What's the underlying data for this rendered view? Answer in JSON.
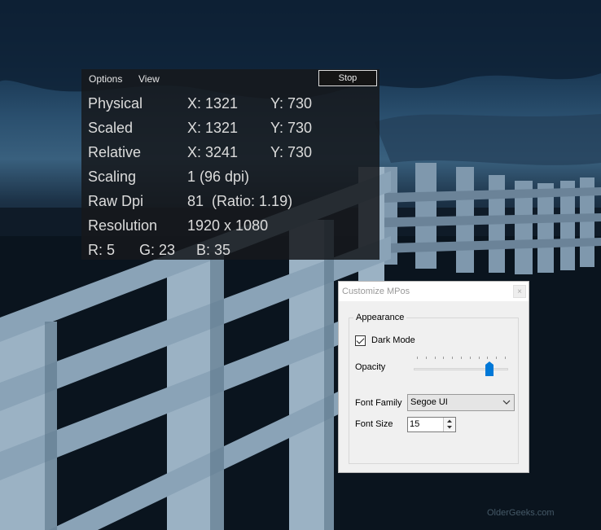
{
  "overlay": {
    "menu": {
      "options": "Options",
      "view": "View"
    },
    "stop_label": "Stop",
    "rows": [
      {
        "label": "Physical",
        "x": "X: 1321",
        "y": "Y: 730"
      },
      {
        "label": "Scaled",
        "x": "X: 1321",
        "y": "Y: 730"
      },
      {
        "label": "Relative",
        "x": "X: 3241",
        "y": "Y: 730"
      },
      {
        "label": "Scaling",
        "value": "1 (96 dpi)"
      },
      {
        "label": "Raw Dpi",
        "value": "81  (Ratio: 1.19)"
      },
      {
        "label": "Resolution",
        "value": "1920 x 1080"
      }
    ],
    "rgb": {
      "r": "R: 5",
      "g": "G: 23",
      "b": "B: 35"
    }
  },
  "dialog": {
    "title": "Customize MPos",
    "close_label": "×",
    "appearance_label": "Appearance",
    "dark_mode_label": "Dark Mode",
    "dark_mode_checked": true,
    "opacity_label": "Opacity",
    "opacity_level": 0.83,
    "font_family_label": "Font Family",
    "font_family_value": "Segoe UI",
    "font_size_label": "Font Size",
    "font_size_value": "15"
  },
  "watermark": "OlderGeeks.com",
  "colors": {
    "accent": "#0078d7",
    "overlay_bg": "#16181c",
    "dialog_bg": "#f0f0f0"
  }
}
